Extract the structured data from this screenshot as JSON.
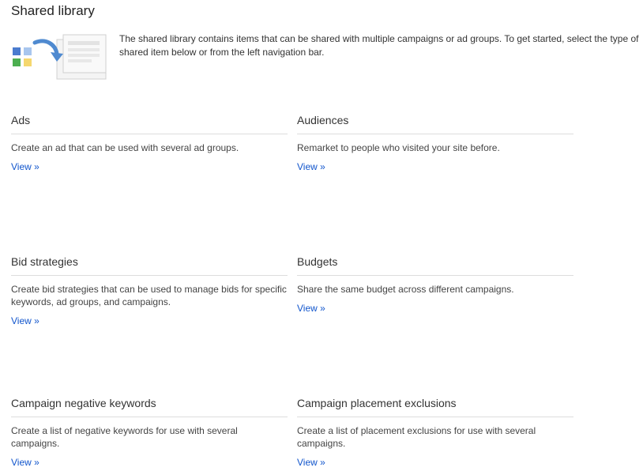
{
  "page": {
    "title": "Shared library",
    "intro": "The shared library contains items that can be shared with multiple campaigns or ad groups. To get started, select the type of shared item below or from the left navigation bar."
  },
  "colors": {
    "link": "#1155cc",
    "divider": "#dddddd",
    "tile_blue": "#4a7ccf",
    "tile_light_blue": "#a8c6ee",
    "tile_green": "#4caf50",
    "tile_yellow": "#f5d76e",
    "arrow": "#4f8ad0"
  },
  "cards": [
    {
      "title": "Ads",
      "description": "Create an ad that can be used with several ad groups.",
      "link": "View »"
    },
    {
      "title": "Audiences",
      "description": "Remarket to people who visited your site before.",
      "link": "View »"
    },
    {
      "title": "Bid strategies",
      "description": "Create bid strategies that can be used to manage bids for specific keywords, ad groups, and campaigns.",
      "link": "View »"
    },
    {
      "title": "Budgets",
      "description": "Share the same budget across different campaigns.",
      "link": "View »"
    },
    {
      "title": "Campaign negative keywords",
      "description": "Create a list of negative keywords for use with several campaigns.",
      "link": "View »"
    },
    {
      "title": "Campaign placement exclusions",
      "description": "Create a list of placement exclusions for use with several campaigns.",
      "link": "View »"
    }
  ]
}
